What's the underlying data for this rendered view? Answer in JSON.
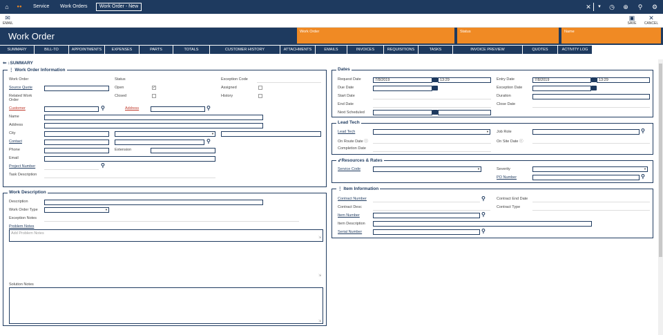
{
  "topnav": {
    "service": "Service",
    "work_orders": "Work Orders",
    "active_tab": "Work Order - New"
  },
  "toolbar": {
    "email": "EMAIL",
    "save": "SAVE",
    "cancel": "CANCEL"
  },
  "header": {
    "title": "Work Order",
    "box1": "Work Order",
    "box2": "Status",
    "box3": "Name",
    "accent": "#f08a24",
    "brand": "#1e3a5f"
  },
  "tabs": [
    "SUMMARY",
    "BILL-TO",
    "APPOINTMENTS",
    "EXPENSES",
    "PARTS",
    "TOTALS",
    "CUSTOMER HISTORY",
    "ATTACHMENTS",
    "EMAILS",
    "INVOICES",
    "REQUISITIONS",
    "TASKS",
    "INVOICE PREVIEW",
    "QUOTES",
    "ACTIVITY LOG"
  ],
  "summary_label": "SUMMARY",
  "woi": {
    "title": "Work Order Information",
    "work_order": "Work Order",
    "source_quote": "Source Quote",
    "related": "Related Work Order",
    "customer": "Customer",
    "name": "Name",
    "address_lbl": "Address",
    "city": "City",
    "contact": "Contact",
    "phone": "Phone",
    "email": "Email",
    "project_number": "Project Number",
    "task_description": "Task Description",
    "status": "Status",
    "open": "Open",
    "closed": "Closed",
    "address_link": "Address",
    "extension": "Extension",
    "exception_code": "Exception Code",
    "assigned": "Assigned",
    "history": "History"
  },
  "wd": {
    "title": "Work Description",
    "description": "Description",
    "type": "Work Order Type",
    "exception_notes": "Exception Notes",
    "problem_notes": "Problem Notes",
    "problem_placeholder": "Add Problem Notes",
    "solution_notes": "Solution Notes"
  },
  "dates": {
    "title": "Dates",
    "request_date": "Request Date",
    "request_val": "7/8/2019",
    "request_time": "13:29",
    "due_date": "Due Date",
    "start_date": "Start Date",
    "end_date": "End Date",
    "next_scheduled": "Next Scheduled",
    "entry_date": "Entry Date",
    "entry_val": "7/8/2019",
    "entry_time": "13:29",
    "exception_date": "Exception Date",
    "duration": "Duration",
    "close_date": "Close Date"
  },
  "lead": {
    "title": "Lead Tech",
    "lead_tech": "Lead Tech",
    "on_route": "On Route Date",
    "completion": "Completion Date",
    "job_role": "Job Role",
    "on_site": "On Site Date"
  },
  "res": {
    "title": "Resources & Rates",
    "service_code": "Service Code",
    "severity": "Severity",
    "po_number": "PO Number"
  },
  "item": {
    "title": "Item Information",
    "contract_number": "Contract Number",
    "contract_desc": "Contract Desc",
    "item_number": "Item Number",
    "item_description": "Item Description",
    "serial_number": "Serial Number",
    "contract_end": "Contract End Date",
    "contract_type": "Contract Type"
  }
}
